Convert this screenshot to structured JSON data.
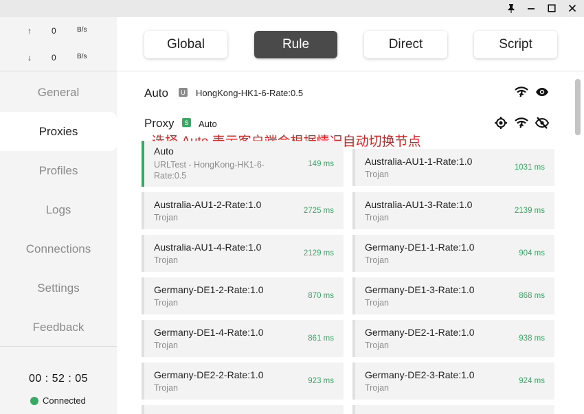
{
  "titlebar": {
    "buttons": [
      {
        "name": "pin-icon"
      },
      {
        "name": "minimize-icon"
      },
      {
        "name": "maximize-icon"
      },
      {
        "name": "close-icon"
      }
    ]
  },
  "sidebar": {
    "traffic": {
      "up_arrow": "↑",
      "up_value": "0",
      "up_unit": "B/s",
      "down_arrow": "↓",
      "down_value": "0",
      "down_unit": "B/s"
    },
    "nav": [
      {
        "label": "General",
        "active": false
      },
      {
        "label": "Proxies",
        "active": true
      },
      {
        "label": "Profiles",
        "active": false
      },
      {
        "label": "Logs",
        "active": false
      },
      {
        "label": "Connections",
        "active": false
      },
      {
        "label": "Settings",
        "active": false
      },
      {
        "label": "Feedback",
        "active": false
      }
    ],
    "uptime": "00 : 52 : 05",
    "status": "Connected",
    "status_color": "#3aa865"
  },
  "modes": [
    {
      "label": "Global",
      "active": false
    },
    {
      "label": "Rule",
      "active": true
    },
    {
      "label": "Direct",
      "active": false
    },
    {
      "label": "Script",
      "active": false
    }
  ],
  "groups": {
    "auto": {
      "title": "Auto",
      "badge": "U",
      "badge_color": "#8c8c8c",
      "now": "HongKong-HK1-6-Rate:0.5",
      "icons": [
        "speed-test-icon",
        "eye-icon"
      ]
    },
    "proxy": {
      "title": "Proxy",
      "badge": "S",
      "badge_color": "#3aa865",
      "now": "Auto",
      "icons": [
        "locate-icon",
        "speed-test-icon",
        "eye-off-icon"
      ]
    }
  },
  "annotation": "选择 Auto 表示客户端会根据情况自动切换节点",
  "proxies": [
    {
      "name": "Auto",
      "type": "URLTest - HongKong-HK1-6-Rate:0.5",
      "latency": "149 ms",
      "selected": true
    },
    {
      "name": "Australia-AU1-1-Rate:1.0",
      "type": "Trojan",
      "latency": "1031 ms",
      "selected": false
    },
    {
      "name": "Australia-AU1-2-Rate:1.0",
      "type": "Trojan",
      "latency": "2725 ms",
      "selected": false
    },
    {
      "name": "Australia-AU1-3-Rate:1.0",
      "type": "Trojan",
      "latency": "2139 ms",
      "selected": false
    },
    {
      "name": "Australia-AU1-4-Rate:1.0",
      "type": "Trojan",
      "latency": "2129 ms",
      "selected": false
    },
    {
      "name": "Germany-DE1-1-Rate:1.0",
      "type": "Trojan",
      "latency": "904 ms",
      "selected": false
    },
    {
      "name": "Germany-DE1-2-Rate:1.0",
      "type": "Trojan",
      "latency": "870 ms",
      "selected": false
    },
    {
      "name": "Germany-DE1-3-Rate:1.0",
      "type": "Trojan",
      "latency": "868 ms",
      "selected": false
    },
    {
      "name": "Germany-DE1-4-Rate:1.0",
      "type": "Trojan",
      "latency": "861 ms",
      "selected": false
    },
    {
      "name": "Germany-DE2-1-Rate:1.0",
      "type": "Trojan",
      "latency": "938 ms",
      "selected": false
    },
    {
      "name": "Germany-DE2-2-Rate:1.0",
      "type": "Trojan",
      "latency": "923 ms",
      "selected": false
    },
    {
      "name": "Germany-DE2-3-Rate:1.0",
      "type": "Trojan",
      "latency": "924 ms",
      "selected": false
    }
  ]
}
